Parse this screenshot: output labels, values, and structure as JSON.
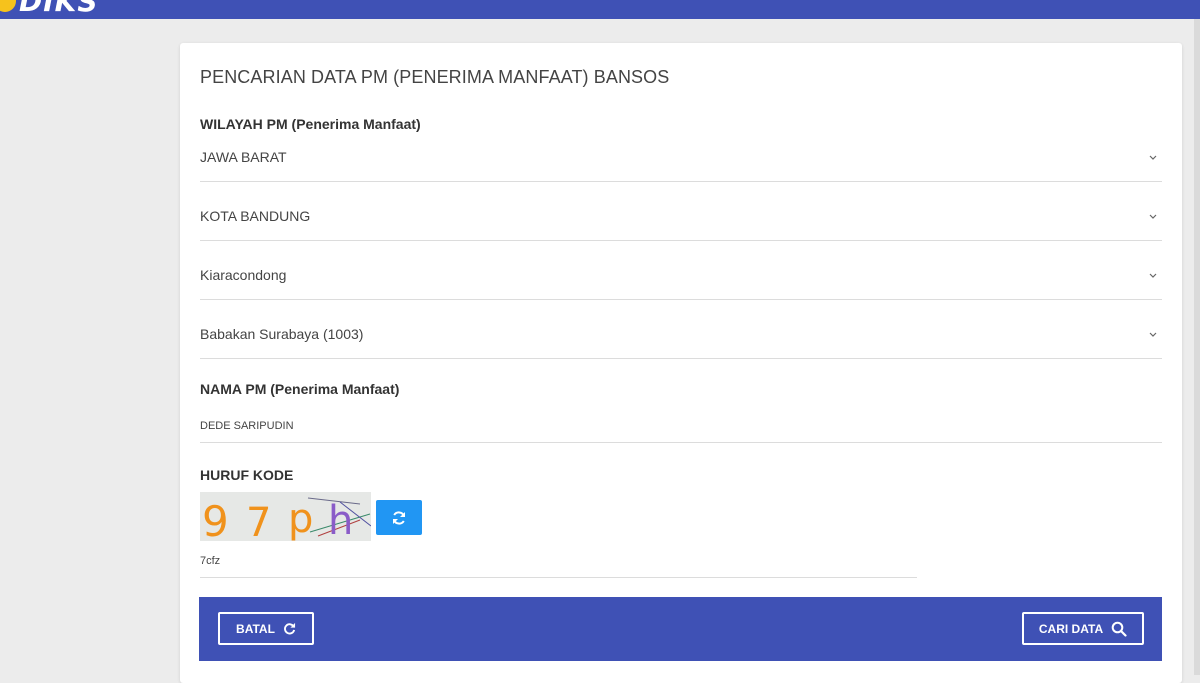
{
  "app": {
    "logo_text": "DIKS"
  },
  "form": {
    "title": "PENCARIAN DATA PM (PENERIMA MANFAAT) BANSOS",
    "wilayah_label": "WILAYAH PM (Penerima Manfaat)",
    "selects": [
      {
        "value": "JAWA BARAT"
      },
      {
        "value": "KOTA BANDUNG"
      },
      {
        "value": "Kiaracondong"
      },
      {
        "value": "Babakan Surabaya (1003)"
      }
    ],
    "nama_label": "NAMA PM (Penerima Manfaat)",
    "nama_value": "DEDE SARIPUDIN",
    "kode_label": "HURUF KODE",
    "captcha_text": "97ph",
    "kode_value": "7cfz"
  },
  "actions": {
    "batal_label": "BATAL",
    "cari_label": "CARI DATA"
  },
  "colors": {
    "primary": "#3f51b5",
    "refresh": "#2196f3",
    "logo_accent": "#f6c21c"
  },
  "icons": {
    "chevron": "chevron-down-icon",
    "refresh": "refresh-icon",
    "reset": "reset-icon",
    "search": "search-icon"
  }
}
